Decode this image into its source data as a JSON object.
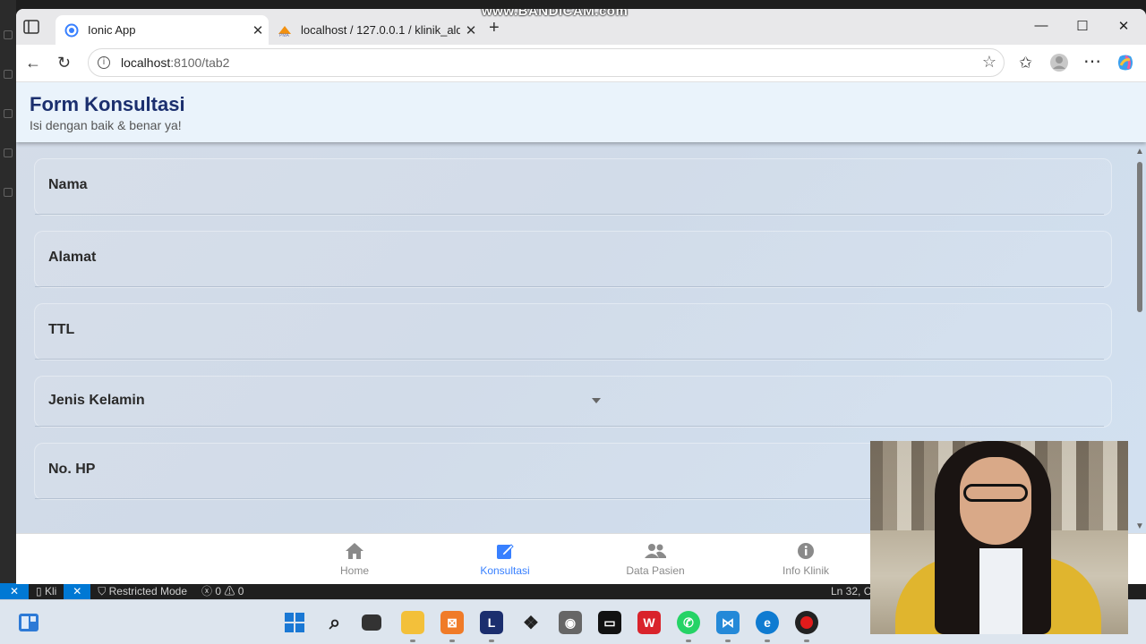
{
  "overlay": {
    "watermark": "www.BANDICAM.com"
  },
  "browser": {
    "tabs": [
      {
        "title": "Ionic App",
        "active": true
      },
      {
        "title": "localhost / 127.0.0.1 / klinik_alda /",
        "active": false
      }
    ],
    "address": {
      "host": "localhost",
      "path": ":8100/tab2"
    }
  },
  "app": {
    "title": "Form Konsultasi",
    "subtitle": "Isi dengan baik & benar ya!",
    "fields": [
      {
        "label": "Nama",
        "type": "text"
      },
      {
        "label": "Alamat",
        "type": "text"
      },
      {
        "label": "TTL",
        "type": "text"
      },
      {
        "label": "Jenis Kelamin",
        "type": "select"
      },
      {
        "label": "No. HP",
        "type": "text"
      }
    ],
    "tabs": [
      {
        "label": "Home",
        "icon": "home-icon",
        "active": false
      },
      {
        "label": "Konsultasi",
        "icon": "create-icon",
        "active": true
      },
      {
        "label": "Data Pasien",
        "icon": "people-icon",
        "active": false
      },
      {
        "label": "Info Klinik",
        "icon": "information-icon",
        "active": false
      }
    ],
    "colors": {
      "primary": "#3880ff",
      "title": "#1b2f6e",
      "header_bg": "#eaf3fb"
    }
  },
  "vscode": {
    "status": {
      "file": "Kli",
      "mode": "Restricted Mode",
      "problems": "0",
      "warnings": "0",
      "cursor": "Ln 32, Col"
    }
  }
}
